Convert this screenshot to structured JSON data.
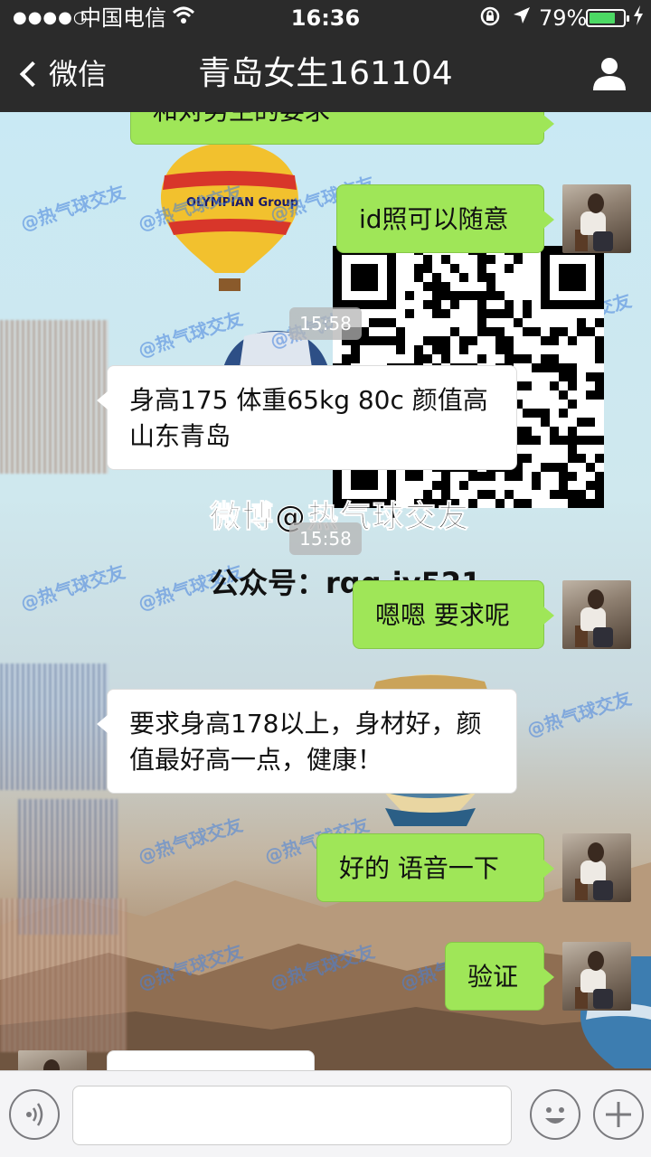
{
  "status_bar": {
    "signal": "●●●●○",
    "carrier": "中国电信",
    "time": "16:36",
    "battery_text": "79%",
    "battery_level": 0.79,
    "icons": [
      "wifi-icon",
      "rotation-lock-icon",
      "location-arrow-icon",
      "battery-icon",
      "charging-icon"
    ]
  },
  "nav": {
    "back_label": "微信",
    "title": "青岛女生161104",
    "right_icon": "profile-icon"
  },
  "background": {
    "watermark": "@热气球交友",
    "poster_title": "微博@热气球交友",
    "poster_account": "公众号：rqq.iy521",
    "balloon_brand": "OLYMPIAN Group"
  },
  "messages": [
    {
      "type": "me",
      "text": "和对男生的要求"
    },
    {
      "type": "me",
      "text": "id照可以随意"
    },
    {
      "type": "time",
      "text": "15:58"
    },
    {
      "type": "them",
      "text": "身高175 体重65kg 80c 颜值高 山东青岛"
    },
    {
      "type": "time",
      "text": "15:58"
    },
    {
      "type": "me",
      "text": "嗯嗯 要求呢"
    },
    {
      "type": "them",
      "text": "要求身高178以上，身材好，颜值最好高一点，健康！"
    },
    {
      "type": "me",
      "text": "好的  语音一下"
    },
    {
      "type": "me",
      "text": "验证"
    }
  ],
  "input_bar": {
    "left_icon": "voice-icon",
    "right_icons": [
      "emoji-icon",
      "plus-icon"
    ],
    "value": "",
    "placeholder": ""
  },
  "colors": {
    "nav_bg": "#2b2b2b",
    "my_bubble": "#9fe658",
    "their_bubble": "#ffffff",
    "battery_green": "#4cd964"
  }
}
